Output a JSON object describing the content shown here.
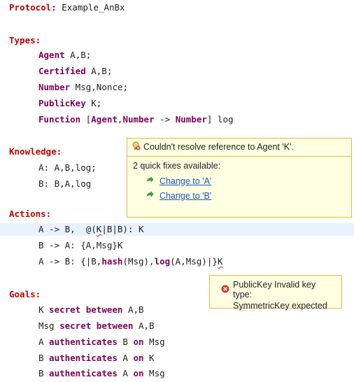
{
  "code": {
    "protocol_keyword": "Protocol:",
    "protocol_name": " Example_AnBx",
    "types_header": "Types:",
    "types": [
      {
        "kw": "Agent",
        "rest": " A,B;"
      },
      {
        "kw": "Certified",
        "rest": " A,B;"
      },
      {
        "kw": "Number",
        "rest": " Msg,Nonce;"
      },
      {
        "kw": "PublicKey",
        "rest": " K;"
      }
    ],
    "function_line": {
      "kw1": "Function",
      "p1": " [",
      "kw2": "Agent",
      "p2": ",",
      "kw3": "Number",
      "p3": " -> ",
      "kw4": "Number",
      "p4": "] log"
    },
    "knowledge_header": "Knowledge:",
    "knowledge": [
      "A: A,B,log;",
      "B: B,A,log"
    ],
    "actions_header": "Actions:",
    "action1": {
      "a": "A -> B,  @(",
      "err": "K",
      "b": "|B|B): K"
    },
    "action2": "B -> A: {A,Msg}K",
    "action3": {
      "a": "A -> B: {|B,",
      "kw1": "hash",
      "b": "(Msg),",
      "kw2": "log",
      "c": "(A,Msg)|}",
      "err": "K"
    },
    "goals_header": "Goals:",
    "goals": [
      {
        "a": "K",
        "kw": " secret between",
        "b": " A,B"
      },
      {
        "a": "Msg",
        "kw": " secret between",
        "b": " A,B"
      },
      {
        "a": "A",
        "kw": " authenticates",
        "b": " B",
        "kw2": " on",
        "c": " Msg"
      },
      {
        "a": "B",
        "kw": " authenticates",
        "b": " A",
        "kw2": " on",
        "c": " K"
      },
      {
        "a": "B",
        "kw": " authenticates",
        "b": " A",
        "kw2": " on",
        "c": " Msg"
      }
    ]
  },
  "quickfix_popup": {
    "title": "Couldn't resolve reference to Agent 'K'.",
    "subtitle": "2 quick fixes available:",
    "fixes": [
      "Change to 'A'",
      "Change to 'B'"
    ]
  },
  "error_tooltip": {
    "line1": "PublicKey Invalid key type:",
    "line2": "SymmetricKey expected"
  },
  "colors": {
    "keyword": "#7f0055",
    "section": "#c00000",
    "link": "#1a55c8",
    "popup_bg": "#ffffe1",
    "popup_border": "#e0b84a",
    "highlight": "#e8f2fe"
  }
}
